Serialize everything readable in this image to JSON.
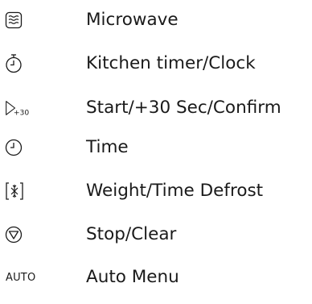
{
  "legend": {
    "items": [
      {
        "icon": "microwave-icon",
        "label": "Microwave"
      },
      {
        "icon": "kitchen-timer-icon",
        "label": "Kitchen timer/Clock"
      },
      {
        "icon": "start-plus30-icon",
        "icon_text": "+30",
        "label": "Start/+30 Sec/Confirm"
      },
      {
        "icon": "clock-icon",
        "label": "Time"
      },
      {
        "icon": "defrost-icon",
        "label": "Weight/Time Defrost"
      },
      {
        "icon": "stop-icon",
        "label": "Stop/Clear"
      },
      {
        "icon": "auto-icon",
        "icon_text": "AUTO",
        "label": "Auto Menu"
      }
    ]
  }
}
